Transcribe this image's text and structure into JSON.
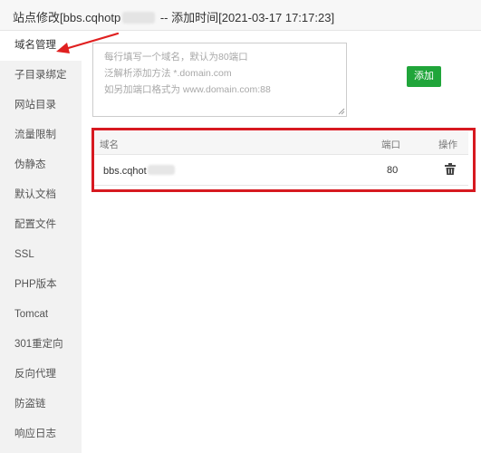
{
  "window": {
    "title_prefix": "站点修改[bbs.cqhotp",
    "title_suffix": "-- 添加时间[2021-03-17 17:17:23]"
  },
  "sidebar": {
    "items": [
      {
        "label": "域名管理",
        "active": true
      },
      {
        "label": "子目录绑定"
      },
      {
        "label": "网站目录"
      },
      {
        "label": "流量限制"
      },
      {
        "label": "伪静态"
      },
      {
        "label": "默认文档"
      },
      {
        "label": "配置文件"
      },
      {
        "label": "SSL"
      },
      {
        "label": "PHP版本"
      },
      {
        "label": "Tomcat"
      },
      {
        "label": "301重定向"
      },
      {
        "label": "反向代理"
      },
      {
        "label": "防盗链"
      },
      {
        "label": "响应日志"
      }
    ]
  },
  "domain_input": {
    "placeholder_lines": [
      "每行填写一个域名，默认为80端口",
      "泛解析添加方法 *.domain.com",
      "如另加端口格式为 www.domain.com:88"
    ],
    "value": ""
  },
  "add_button": {
    "label": "添加"
  },
  "domain_table": {
    "columns": [
      "域名",
      "端口",
      "操作"
    ],
    "rows": [
      {
        "domain": "bbs.cqhot",
        "port": "80",
        "action_icon": "trash-icon"
      }
    ]
  },
  "colors": {
    "accent_green": "#20a53a",
    "annotation_red": "#d71920"
  }
}
